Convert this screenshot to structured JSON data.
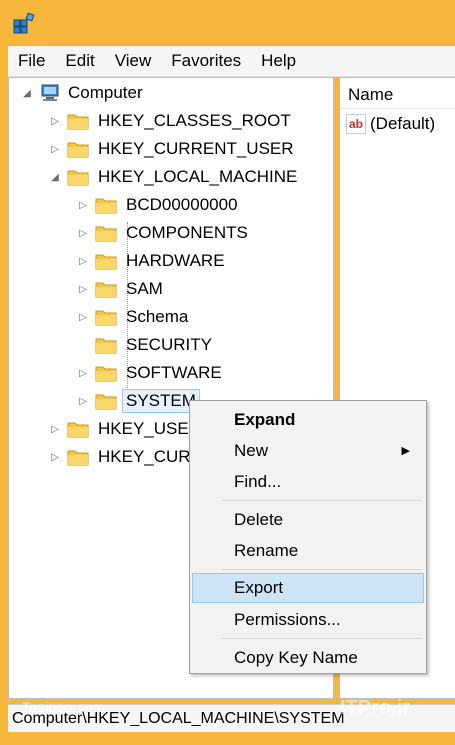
{
  "menubar": {
    "items": [
      "File",
      "Edit",
      "View",
      "Favorites",
      "Help"
    ]
  },
  "tree": {
    "root": "Computer",
    "hives": [
      "HKEY_CLASSES_ROOT",
      "HKEY_CURRENT_USER",
      "HKEY_LOCAL_MACHINE"
    ],
    "hklm_children": [
      "BCD00000000",
      "COMPONENTS",
      "HARDWARE",
      "SAM",
      "Schema",
      "SECURITY",
      "SOFTWARE",
      "SYSTEM"
    ],
    "other_hives": [
      "HKEY_USER",
      "HKEY_CURR"
    ]
  },
  "list": {
    "column_name": "Name",
    "rows": [
      "(Default)"
    ]
  },
  "context_menu": {
    "expand": "Expand",
    "new": "New",
    "find": "Find...",
    "delete": "Delete",
    "rename": "Rename",
    "export": "Export",
    "permissions": "Permissions...",
    "copy_key_name": "Copy Key Name"
  },
  "status": {
    "path": "Computer\\HKEY_LOCAL_MACHINE\\SYSTEM"
  },
  "watermark": {
    "left": "Tosinso.com",
    "right": "ITPro.ir"
  },
  "colors": {
    "titlebar": "#f6b73c",
    "selection": "#e5f1fb",
    "menu_hover": "#cde4f7",
    "folder": "#f5c842"
  }
}
